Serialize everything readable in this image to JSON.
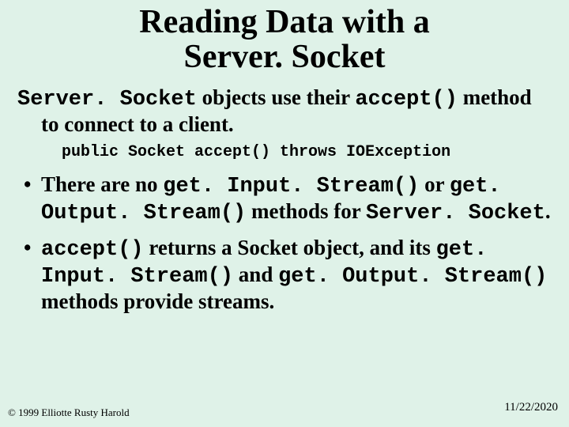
{
  "title_line1": "Reading Data with a",
  "title_line2": "Server. Socket",
  "intro": {
    "pre": "",
    "code1": "Server. Socket",
    "mid1": " objects use their ",
    "code2": "accept()",
    "post": " method to connect to a client."
  },
  "signature": "public Socket accept() throws IOException",
  "bullet1": {
    "t1": "There are no ",
    "c1": "get. Input. Stream()",
    "t2": " or ",
    "c2": "get. Output. Stream()",
    "t3": " methods for ",
    "c3": "Server. Socket",
    "t4": "."
  },
  "bullet2": {
    "c1": "accept()",
    "t1": " returns a Socket object, and its ",
    "c2": "get. Input. Stream()",
    "t2": " and ",
    "c3": "get. Output. Stream()",
    "t3": " methods provide streams."
  },
  "copyright": "© 1999 Elliotte Rusty Harold",
  "date": "11/22/2020"
}
